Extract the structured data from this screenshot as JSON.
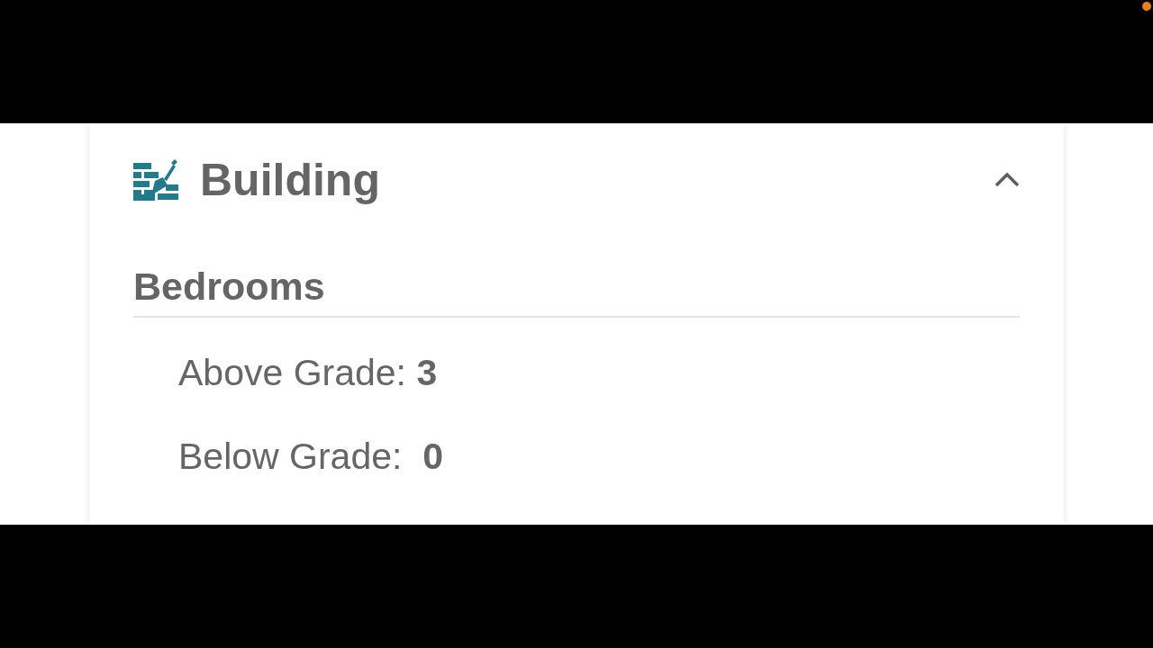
{
  "section": {
    "title": "Building",
    "expanded": true
  },
  "group": {
    "heading": "Bedrooms",
    "rows": [
      "Above Grade: **3**",
      "Below Grade:  **0**"
    ]
  }
}
